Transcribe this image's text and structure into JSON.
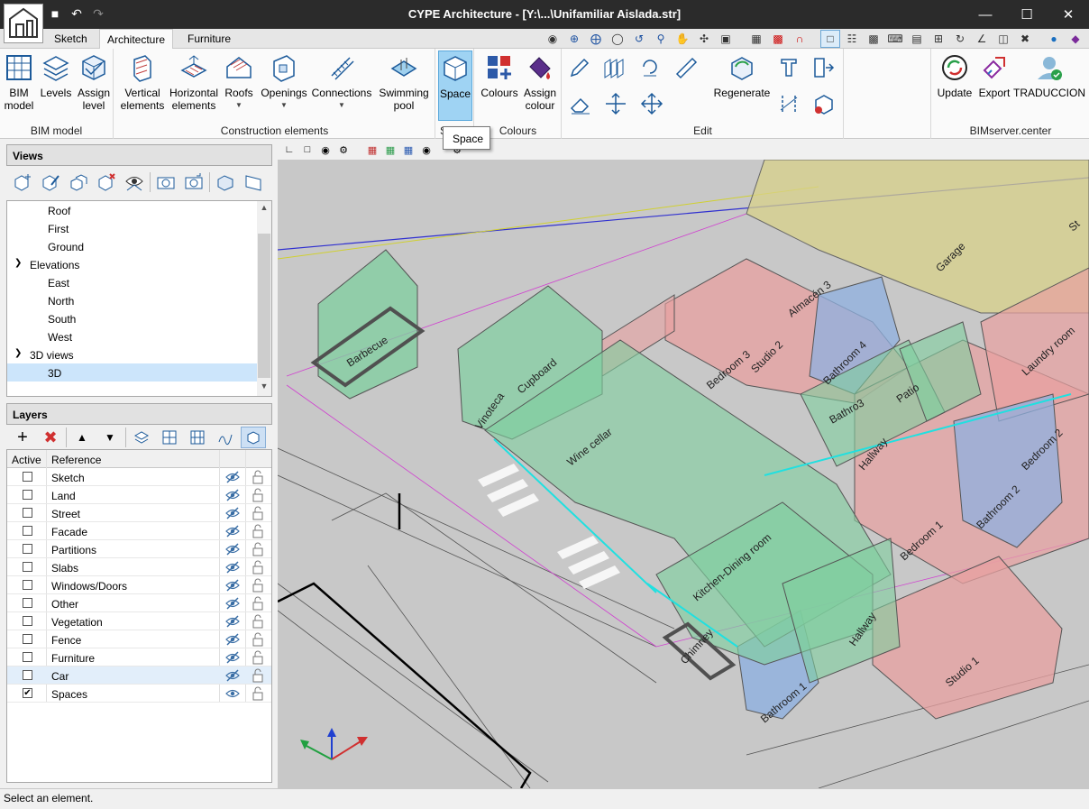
{
  "window": {
    "title": "CYPE Architecture - [Y:\\...\\Unifamiliar Aislada.str]",
    "minimize": "—",
    "maximize": "☐",
    "close": "✕"
  },
  "tabs": [
    {
      "label": "Sketch",
      "active": false
    },
    {
      "label": "Architecture",
      "active": true
    },
    {
      "label": "Furniture",
      "active": false
    }
  ],
  "ribbon": {
    "groups": {
      "bim_model": "BIM model",
      "construction": "Construction elements",
      "spaces": "S",
      "colours": "Colours",
      "edit": "Edit",
      "bimserver": "BIMserver.center"
    },
    "buttons": {
      "bim_model": "BIM\nmodel",
      "levels": "Levels",
      "assign_level": "Assign\nlevel",
      "vertical_elements": "Vertical\nelements",
      "horizontal_elements": "Horizontal\nelements",
      "roofs": "Roofs",
      "openings": "Openings",
      "connections": "Connections",
      "swimming_pool": "Swimming\npool",
      "space": "Space",
      "colours": "Colours",
      "assign_colour": "Assign\ncolour",
      "regenerate": "Regenerate",
      "update": "Update",
      "export": "Export",
      "traduccion": "TRADUCCION"
    }
  },
  "tooltip": "Space",
  "views_panel": {
    "title": "Views",
    "tree": [
      {
        "label": "Roof",
        "level": 2
      },
      {
        "label": "First",
        "level": 2
      },
      {
        "label": "Ground",
        "level": 2
      },
      {
        "label": "Elevations",
        "level": 1,
        "expanded": true
      },
      {
        "label": "East",
        "level": 2
      },
      {
        "label": "North",
        "level": 2
      },
      {
        "label": "South",
        "level": 2
      },
      {
        "label": "West",
        "level": 2
      },
      {
        "label": "3D views",
        "level": 1,
        "expanded": true
      },
      {
        "label": "3D",
        "level": 2,
        "selected": true
      }
    ]
  },
  "layers_panel": {
    "title": "Layers",
    "col_active": "Active",
    "col_reference": "Reference",
    "rows": [
      {
        "name": "Sketch",
        "active": false,
        "visible": false
      },
      {
        "name": "Land",
        "active": false,
        "visible": false
      },
      {
        "name": "Street",
        "active": false,
        "visible": false
      },
      {
        "name": "Facade",
        "active": false,
        "visible": false
      },
      {
        "name": "Partitions",
        "active": false,
        "visible": false
      },
      {
        "name": "Slabs",
        "active": false,
        "visible": false
      },
      {
        "name": "Windows/Doors",
        "active": false,
        "visible": false
      },
      {
        "name": "Other",
        "active": false,
        "visible": false
      },
      {
        "name": "Vegetation",
        "active": false,
        "visible": false
      },
      {
        "name": "Fence",
        "active": false,
        "visible": false
      },
      {
        "name": "Furniture",
        "active": false,
        "visible": false
      },
      {
        "name": "Car",
        "active": false,
        "visible": false,
        "selected": true
      },
      {
        "name": "Spaces",
        "active": true,
        "visible": true
      }
    ]
  },
  "spaces": {
    "barbecue": "Barbecue",
    "vinoteca": "Vinoteca",
    "cupboard": "Cupboard",
    "wine_cellar": "Wine cellar",
    "kitchen": "Kitchen-Dining room",
    "chimney": "Chimney",
    "bathroom1": "Bathroom 1",
    "hallway": "Hallway",
    "hallway2": "Hallway",
    "studio1": "Studio 1",
    "studio2": "Studio 2",
    "bedroom1": "Bedroom 1",
    "bedroom2": "Bedroom 2",
    "bedroom3": "Bedroom 3",
    "bathroom2": "Bathroom 2",
    "bathroom3": "Bathro3",
    "bathroom4": "Bathroom 4",
    "patio": "Patio",
    "almacen": "Almacén 3",
    "garage": "Garage",
    "laundry": "Laundry room",
    "st": "St"
  },
  "status": "Select an element.",
  "colors": {
    "accent": "#9fd3f3",
    "green_space": "#7fcf9f",
    "red_space": "#e8a0a0",
    "blue_space": "#8fb0e0",
    "yellow_space": "#d8d28a"
  }
}
